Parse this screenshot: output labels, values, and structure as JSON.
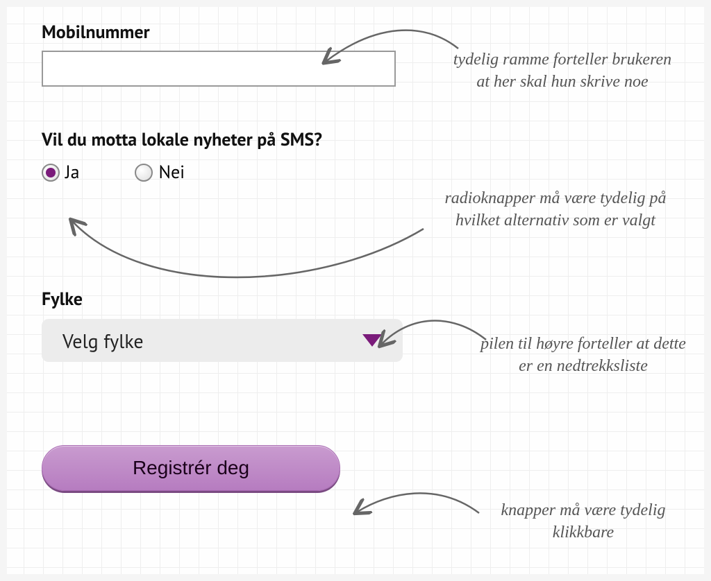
{
  "form": {
    "mobile_label": "Mobilnummer",
    "mobile_value": "",
    "sms_question": "Vil du motta lokale nyheter på SMS?",
    "radio_yes": "Ja",
    "radio_no": "Nei",
    "radio_selected": "Ja",
    "fylke_label": "Fylke",
    "fylke_placeholder": "Velg fylke",
    "register_label": "Registrér deg"
  },
  "annotations": {
    "a1": "tydelig ramme forteller brukeren at her skal hun skrive noe",
    "a2": "radioknapper må være tydelig på hvilket alternativ som er valgt",
    "a3": "pilen til høyre forteller at dette er en nedtrekksliste",
    "a4": "knapper må være tydelig klikkbare"
  },
  "colors": {
    "accent": "#7a1b7a",
    "button_grad_top": "#c99bcf",
    "button_grad_bot": "#b67cc0"
  }
}
